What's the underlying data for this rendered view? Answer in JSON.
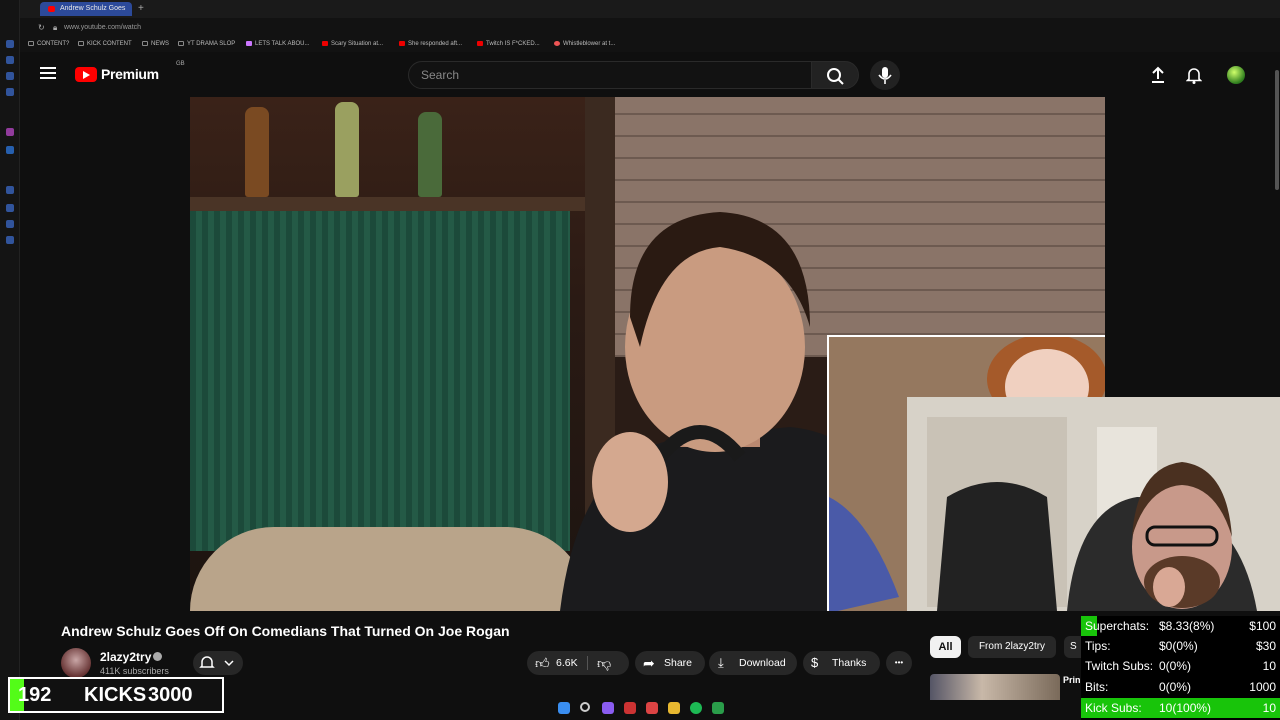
{
  "browser": {
    "tab_title": "Andrew Schulz Goes",
    "url": "www.youtube.com/watch",
    "bookmarks": [
      "CONTENT?",
      "KICK CONTENT",
      "NEWS",
      "YT DRAMA SLOP",
      "LETS TALK ABOU...",
      "Scary Situation at...",
      "She responded aft...",
      "Twitch IS F*CKED...",
      "Whistleblower at t..."
    ]
  },
  "header": {
    "logo_text": "Premium",
    "region": "GB",
    "search_placeholder": "Search"
  },
  "video": {
    "title": "Andrew Schulz Goes Off On Comedians That Turned On Joe Rogan",
    "channel": "2lazy2try",
    "subscribers": "411K subscribers",
    "likes": "6.6K",
    "share_label": "Share",
    "download_label": "Download",
    "thanks_label": "Thanks",
    "more_label": "•••"
  },
  "filters": [
    "All",
    "From 2lazy2try",
    "S"
  ],
  "related": {
    "title_fragment": "Prin"
  },
  "overlay": {
    "kicks_current": "192",
    "kicks_label": "KICKS",
    "kicks_goal": "3000",
    "kicks_progress": 0.064,
    "stats": [
      {
        "name": "Superchats:",
        "value": "$8.33(8%)",
        "goal": "$100",
        "progress": 0.08
      },
      {
        "name": "Tips:",
        "value": "$0(0%)",
        "goal": "$30",
        "progress": 0
      },
      {
        "name": "Twitch Subs:",
        "value": "0(0%)",
        "goal": "10",
        "progress": 0
      },
      {
        "name": "Bits:",
        "value": "0(0%)",
        "goal": "1000",
        "progress": 0
      },
      {
        "name": "Kick Subs:",
        "value": "10(100%)",
        "goal": "10",
        "progress": 1.0
      }
    ]
  },
  "colors": {
    "youtube_red": "#ff0000",
    "kick_green": "#53fc18",
    "stat_green": "#18c40a"
  }
}
